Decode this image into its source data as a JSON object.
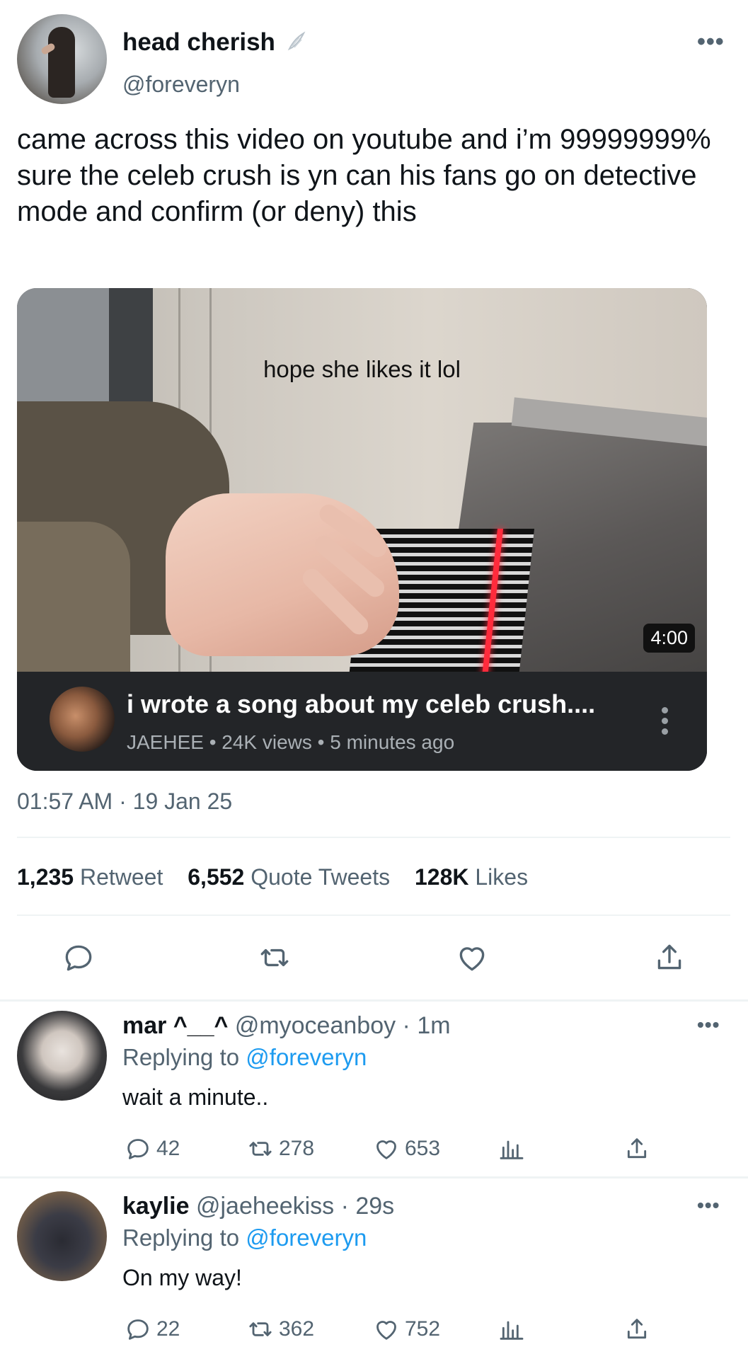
{
  "tweet": {
    "display_name": "head cherish",
    "badge_icon": "angel-wing-icon",
    "handle": "@foreveryn",
    "text": "came across this video on youtube and i’m 99999999% sure the celeb crush is yn can his fans go on detective mode and confirm (or deny) this",
    "timestamp": "01:57 AM · 19 Jan 25",
    "stats": {
      "retweets_count": "1,235",
      "retweets_label": "Retweet",
      "quotes_count": "6,552",
      "quotes_label": "Quote Tweets",
      "likes_count": "128K",
      "likes_label": "Likes"
    },
    "actions": [
      "reply-icon",
      "retweet-icon",
      "like-icon",
      "share-icon"
    ]
  },
  "video": {
    "caption": "hope she likes it lol",
    "duration": "4:00",
    "title": "i wrote a song about my celeb crush....",
    "meta": "JAEHEE • 24K views • 5 minutes ago"
  },
  "replies": [
    {
      "display_name": "mar ^__^",
      "handle_time": "@myoceanboy · 1m",
      "replying_prefix": "Replying to",
      "replying_handle": "@foreveryn",
      "text": "wait a minute..",
      "reply_count": "42",
      "retweet_count": "278",
      "like_count": "653"
    },
    {
      "display_name": "kaylie",
      "handle_time": "@jaeheekiss · 29s",
      "replying_prefix": "Replying to",
      "replying_handle": "@foreveryn",
      "text": "On my way!",
      "reply_count": "22",
      "retweet_count": "362",
      "like_count": "752"
    }
  ],
  "colors": {
    "link": "#1d9bf0",
    "secondary_text": "#536471",
    "primary_text": "#0f1419",
    "video_footer": "#232528"
  }
}
